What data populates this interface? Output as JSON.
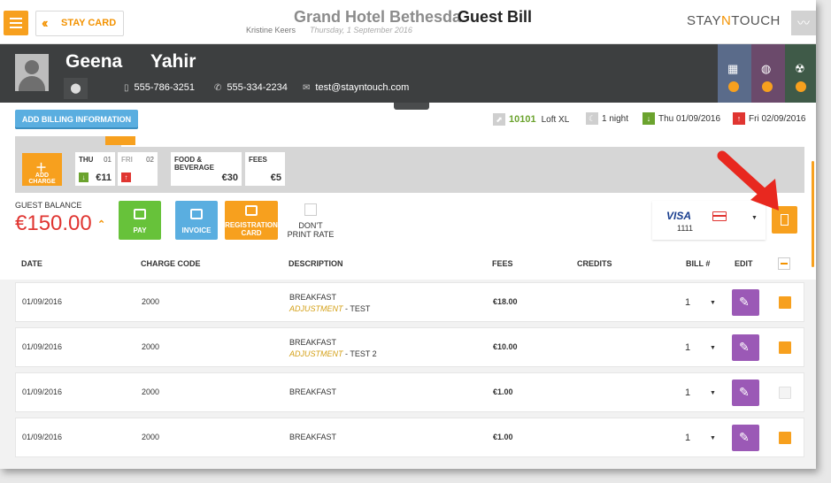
{
  "header": {
    "back_label": "STAY CARD",
    "hotel_name": "Grand Hotel Bethesda",
    "page_title": "Guest Bill",
    "user_name": "Kristine Keers",
    "date": "Thursday, 1 September 2016",
    "logo": {
      "pre": "STAY",
      "mid": "N",
      "post": "TOUCH"
    }
  },
  "guest": {
    "first_name": "Geena",
    "last_name": "Yahir",
    "phone_mobile": "555-786-3251",
    "phone_home": "555-334-2234",
    "email": "test@stayntouch.com"
  },
  "tiles": [
    {
      "color": "#5a6b8a",
      "icon": "hotel-icon"
    },
    {
      "color": "#6b4a6b",
      "icon": "globe-icon"
    },
    {
      "color": "#3f5a48",
      "icon": "biohazard-icon"
    }
  ],
  "info": {
    "add_billing_label": "ADD BILLING INFORMATION",
    "room_number": "10101",
    "room_type": "Loft XL",
    "nights": "1 night",
    "arrival": "Thu 01/09/2016",
    "departure": "Fri 02/09/2016"
  },
  "strip": {
    "add_charge_label": "ADD CHARGE",
    "days": [
      {
        "name": "THU",
        "num": "01",
        "amount": "€11",
        "arrow": "down",
        "color": "#6ba32e"
      },
      {
        "name": "FRI",
        "num": "02",
        "amount": "",
        "arrow": "up",
        "color": "#e03531"
      }
    ],
    "categories": [
      {
        "name": "FOOD & BEVERAGE",
        "amount": "€30"
      },
      {
        "name": "FEES",
        "amount": "€5"
      }
    ]
  },
  "balance": {
    "label": "GUEST BALANCE",
    "amount": "€150.00"
  },
  "actions": {
    "pay": "PAY",
    "invoice": "INVOICE",
    "registration_card": "REGISTRATION CARD",
    "dont_print_rate": "DON'T PRINT RATE"
  },
  "card": {
    "brand": "VISA",
    "number": "1111"
  },
  "table": {
    "columns": [
      "DATE",
      "CHARGE CODE",
      "DESCRIPTION",
      "FEES",
      "CREDITS",
      "BILL #",
      "EDIT"
    ],
    "rows": [
      {
        "date": "01/09/2016",
        "code": "2000",
        "desc": "BREAKFAST",
        "adj": "ADJUSTMENT",
        "adj_note": " - TEST",
        "fees": "€18.00",
        "bill": "1",
        "checked": true
      },
      {
        "date": "01/09/2016",
        "code": "2000",
        "desc": "BREAKFAST",
        "adj": "ADJUSTMENT",
        "adj_note": " - TEST 2",
        "fees": "€10.00",
        "bill": "1",
        "checked": true
      },
      {
        "date": "01/09/2016",
        "code": "2000",
        "desc": "BREAKFAST",
        "adj": "",
        "adj_note": "",
        "fees": "€1.00",
        "bill": "1",
        "checked": false
      },
      {
        "date": "01/09/2016",
        "code": "2000",
        "desc": "BREAKFAST",
        "adj": "",
        "adj_note": "",
        "fees": "€1.00",
        "bill": "1",
        "checked": true
      }
    ]
  },
  "colors": {
    "accent": "#f7a01e",
    "balance": "#e03531",
    "pay": "#67c23a",
    "invoice": "#5aaee0",
    "edit": "#9b59b6"
  }
}
